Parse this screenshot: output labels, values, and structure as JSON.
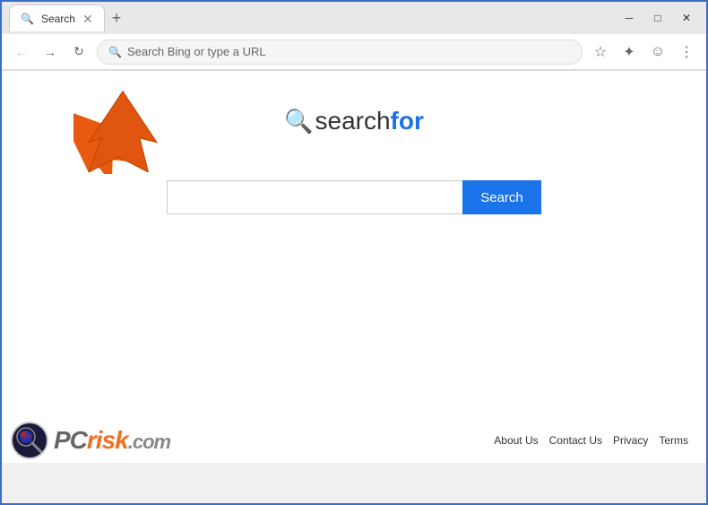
{
  "window": {
    "title": "Search",
    "close_label": "✕",
    "minimize_label": "─",
    "maximize_label": "□",
    "new_tab_label": "+"
  },
  "addressbar": {
    "placeholder": "Search Bing or type a URL",
    "url_icon": "🔍",
    "back_icon": "←",
    "forward_icon": "→",
    "refresh_icon": "↻"
  },
  "toolbar": {
    "star_icon": "☆",
    "extensions_icon": "🧩",
    "profile_icon": "👤",
    "menu_icon": "⋮"
  },
  "logo": {
    "icon": "🔍",
    "text_part1": "search",
    "text_part2": "for"
  },
  "search": {
    "input_placeholder": "",
    "button_label": "Search"
  },
  "footer": {
    "about_label": "About Us",
    "contact_label": "Contact Us",
    "privacy_label": "Privacy",
    "terms_label": "Terms"
  },
  "pcrisk": {
    "text": "PCrisk.com"
  }
}
